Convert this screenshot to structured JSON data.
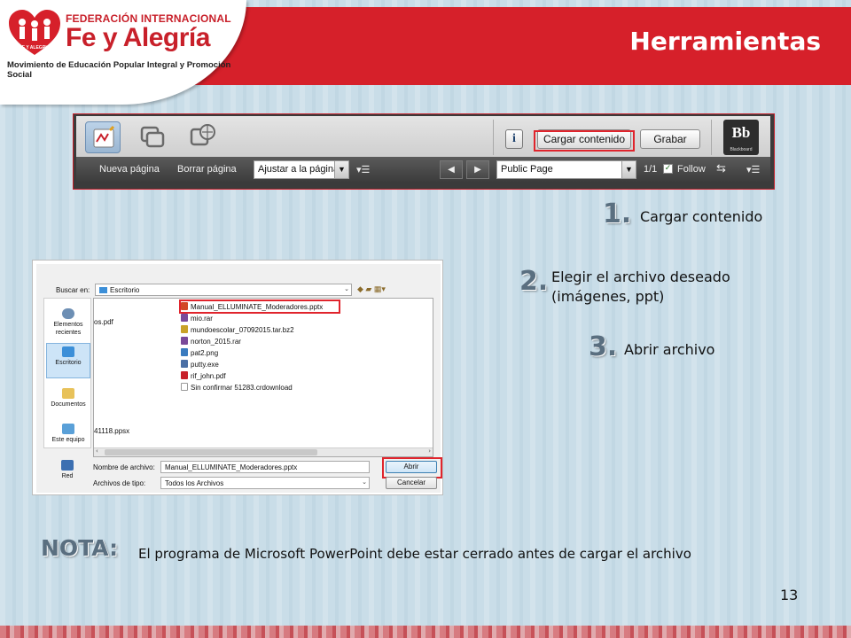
{
  "header": {
    "org_line1": "FEDERACIÓN INTERNACIONAL",
    "org_line2": "Fe y Alegría",
    "org_line3": "Movimiento de Educación Popular Integral y Promoción Social",
    "heart_logo_text": "FE Y ALEGRIA",
    "title": "Herramientas",
    "brand_color": "#d6202a"
  },
  "toolbar": {
    "load_content_label": "Cargar contenido",
    "record_label": "Grabar",
    "info_icon": "i",
    "blackboard_logo": "Bb",
    "blackboard_sub": "Blackboard",
    "new_page_label": "Nueva página",
    "delete_page_label": "Borrar página",
    "zoom_select_value": "Ajustar a la página",
    "page_select_value": "Public Page",
    "page_count": "1/1",
    "follow_label": "Follow",
    "follow_checked": true
  },
  "steps": [
    {
      "number": "1.",
      "text": "Cargar contenido"
    },
    {
      "number": "2.",
      "text_line1": "Elegir el archivo deseado",
      "text_line2": "(imágenes, ppt)"
    },
    {
      "number": "3.",
      "text": "Abrir archivo"
    }
  ],
  "dialog": {
    "look_in_label": "Buscar en:",
    "look_in_value": "Escritorio",
    "places": [
      "Elementos recientes",
      "Escritorio",
      "Documentos",
      "Este equipo",
      "Red"
    ],
    "selected_place": "Escritorio",
    "left_column_files": [
      "os.pdf",
      "41118.ppsx"
    ],
    "files": [
      {
        "name": "Manual_ELLUMINATE_Moderadores.pptx",
        "icon": "pptx-icon",
        "color": "#d24726"
      },
      {
        "name": "mio.rar",
        "icon": "rar-icon",
        "color": "#7a4a9a"
      },
      {
        "name": "mundoescolar_07092015.tar.bz2",
        "icon": "archive-icon",
        "color": "#c9a227"
      },
      {
        "name": "norton_2015.rar",
        "icon": "rar-icon",
        "color": "#7a4a9a"
      },
      {
        "name": "pat2.png",
        "icon": "image-icon",
        "color": "#3a7bbf"
      },
      {
        "name": "putty.exe",
        "icon": "exe-icon",
        "color": "#4a6fa5"
      },
      {
        "name": "rif_john.pdf",
        "icon": "pdf-icon",
        "color": "#c8202a"
      },
      {
        "name": "Sin confirmar 51283.crdownload",
        "icon": "file-icon",
        "color": "#ffffff"
      }
    ],
    "filename_label": "Nombre de archivo:",
    "filename_value": "Manual_ELLUMINATE_Moderadores.pptx",
    "filetype_label": "Archivos de tipo:",
    "filetype_value": "Todos los Archivos",
    "open_label": "Abrir",
    "cancel_label": "Cancelar"
  },
  "note": {
    "label": "NOTA:",
    "text": "El programa de Microsoft PowerPoint debe estar cerrado antes de cargar el archivo"
  },
  "page_number": "13"
}
